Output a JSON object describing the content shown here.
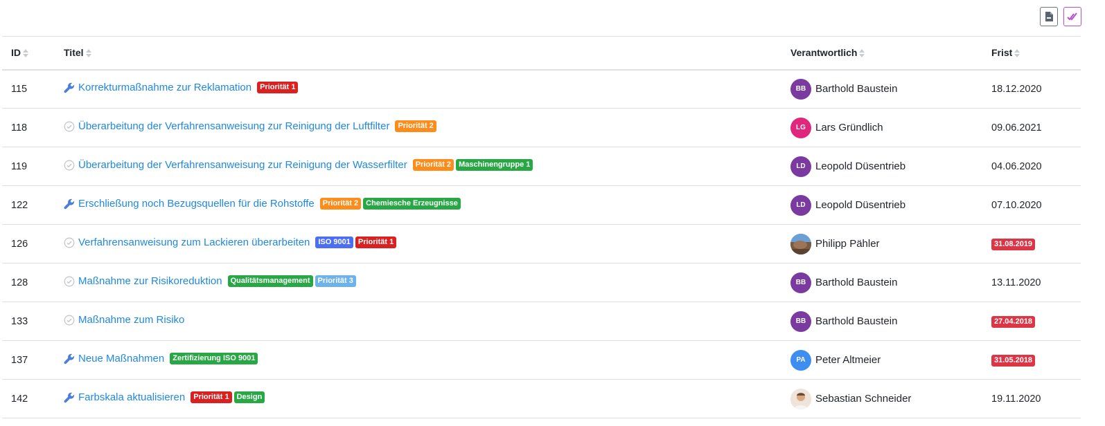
{
  "toolbar": {
    "export_icon": "file-export-icon",
    "select_icon": "double-check-icon"
  },
  "columns": {
    "id": "ID",
    "title": "Titel",
    "owner": "Verantwortlich",
    "due": "Frist"
  },
  "colors": {
    "link": "#1e88e5",
    "priority1": "#dc1f1f",
    "priority2": "#fd8c1a",
    "priority3": "#6cb2eb",
    "green": "#28a745",
    "iso": "#4c6ef5",
    "overdue": "#dc3545"
  },
  "rows": [
    {
      "id": "115",
      "type": "wrench-icon",
      "title": "Korrekturmaßnahme zur Reklamation",
      "badges": [
        {
          "label": "Priorität 1",
          "color": "#dc1f1f"
        }
      ],
      "owner": {
        "initials": "BB",
        "name": "Barthold Baustein",
        "color": "#7b3aa0",
        "photo": ""
      },
      "due": "18.12.2020",
      "overdue": false
    },
    {
      "id": "118",
      "type": "check-circle-icon",
      "title": "Überarbeitung der Verfahrensanweisung zur Reinigung der Luftfilter",
      "badges": [
        {
          "label": "Priorität 2",
          "color": "#fd8c1a"
        }
      ],
      "owner": {
        "initials": "LG",
        "name": "Lars Gründlich",
        "color": "#e0267d",
        "photo": ""
      },
      "due": "09.06.2021",
      "overdue": false
    },
    {
      "id": "119",
      "type": "check-circle-icon",
      "title": "Überarbeitung der Verfahrensanweisung zur Reinigung der Wasserfilter",
      "badges": [
        {
          "label": "Priorität 2",
          "color": "#fd8c1a"
        },
        {
          "label": "Maschinengruppe 1",
          "color": "#28a745"
        }
      ],
      "owner": {
        "initials": "LD",
        "name": "Leopold Düsentrieb",
        "color": "#7b3aa0",
        "photo": ""
      },
      "due": "04.06.2020",
      "overdue": false
    },
    {
      "id": "122",
      "type": "wrench-icon",
      "title": "Erschließung noch Bezugsquellen für die Rohstoffe",
      "badges": [
        {
          "label": "Priorität 2",
          "color": "#fd8c1a"
        },
        {
          "label": "Chemiesche Erzeugnisse",
          "color": "#28a745"
        }
      ],
      "owner": {
        "initials": "LD",
        "name": "Leopold Düsentrieb",
        "color": "#7b3aa0",
        "photo": ""
      },
      "due": "07.10.2020",
      "overdue": false
    },
    {
      "id": "126",
      "type": "check-circle-icon",
      "title": "Verfahrensanweisung zum Lackieren überarbeiten",
      "badges": [
        {
          "label": "ISO 9001",
          "color": "#4c6ef5"
        },
        {
          "label": "Priorität 1",
          "color": "#dc1f1f"
        }
      ],
      "owner": {
        "initials": "",
        "name": "Philipp Pähler",
        "color": "#8a6d55",
        "photo": "landscape"
      },
      "due": "31.08.2019",
      "overdue": true
    },
    {
      "id": "128",
      "type": "check-circle-icon",
      "title": "Maßnahme zur Risikoreduktion",
      "badges": [
        {
          "label": "Qualitätsmanagement",
          "color": "#28a745"
        },
        {
          "label": "Priorität 3",
          "color": "#6cb2eb"
        }
      ],
      "owner": {
        "initials": "BB",
        "name": "Barthold Baustein",
        "color": "#7b3aa0",
        "photo": ""
      },
      "due": "13.11.2020",
      "overdue": false
    },
    {
      "id": "133",
      "type": "check-circle-icon",
      "title": "Maßnahme zum Risiko",
      "badges": [],
      "owner": {
        "initials": "BB",
        "name": "Barthold Baustein",
        "color": "#7b3aa0",
        "photo": ""
      },
      "due": "27.04.2018",
      "overdue": true
    },
    {
      "id": "137",
      "type": "wrench-icon",
      "title": "Neue Maßnahmen",
      "badges": [
        {
          "label": "Zertifizierung ISO 9001",
          "color": "#28a745"
        }
      ],
      "owner": {
        "initials": "PA",
        "name": "Peter Altmeier",
        "color": "#3d8ef0",
        "photo": ""
      },
      "due": "31.05.2018",
      "overdue": true
    },
    {
      "id": "142",
      "type": "wrench-icon",
      "title": "Farbskala aktualisieren",
      "badges": [
        {
          "label": "Priorität 1",
          "color": "#dc1f1f"
        },
        {
          "label": "Design",
          "color": "#28a745"
        }
      ],
      "owner": {
        "initials": "",
        "name": "Sebastian Schneider",
        "color": "#f0e0d0",
        "photo": "portrait"
      },
      "due": "19.11.2020",
      "overdue": false
    }
  ]
}
